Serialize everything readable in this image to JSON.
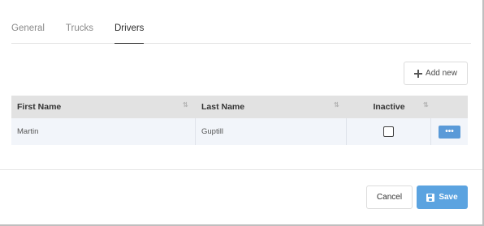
{
  "tabs": [
    {
      "label": "General",
      "active": false
    },
    {
      "label": "Trucks",
      "active": false
    },
    {
      "label": "Drivers",
      "active": true
    }
  ],
  "toolbar": {
    "add_new_label": "Add new",
    "add_new_icon": "plus-icon"
  },
  "table": {
    "columns": [
      {
        "label": "First Name",
        "sortable": true
      },
      {
        "label": "Last Name",
        "sortable": true
      },
      {
        "label": "Inactive",
        "sortable": true
      },
      {
        "label": "",
        "sortable": false
      }
    ],
    "rows": [
      {
        "first_name": "Martin",
        "last_name": "Guptill",
        "inactive": false,
        "actions_label": "•••"
      }
    ],
    "sort_icon": "⇅"
  },
  "footer": {
    "cancel_label": "Cancel",
    "save_label": "Save",
    "save_icon": "floppy-disk-icon"
  },
  "colors": {
    "accent": "#5ba3e0",
    "row_action": "#5a9ad8",
    "header_bg": "#e2e2e2",
    "row_bg": "#f2f5fa"
  }
}
